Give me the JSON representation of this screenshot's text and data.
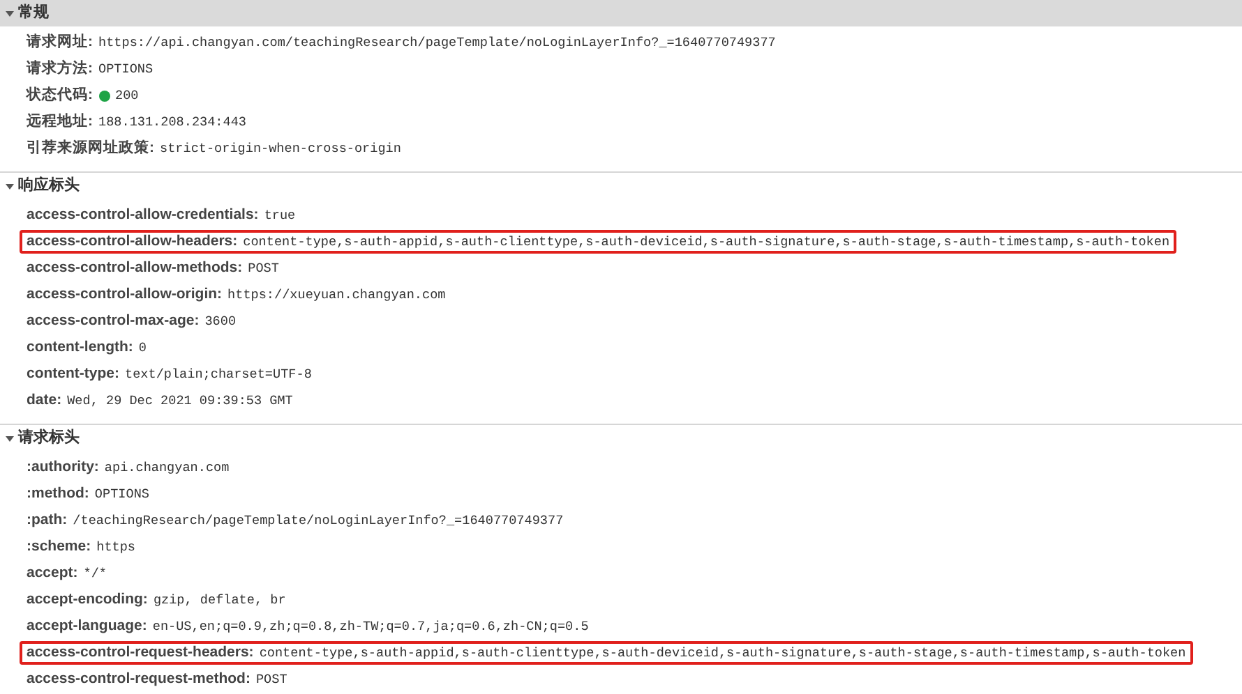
{
  "sections": [
    {
      "title": "常规",
      "expanded": true,
      "selected": true,
      "rows": [
        {
          "name": "请求网址:",
          "value": "https://api.changyan.com/teachingResearch/pageTemplate/noLoginLayerInfo?_=1640770749377",
          "highlighted": false
        },
        {
          "name": "请求方法:",
          "value": "OPTIONS",
          "highlighted": false
        },
        {
          "name": "状态代码:",
          "value": "200",
          "highlighted": false,
          "color": "#1ea446"
        },
        {
          "name": "远程地址:",
          "value": "188.131.208.234:443",
          "highlighted": false
        },
        {
          "name": "引荐来源网址政策:",
          "value": "strict-origin-when-cross-origin",
          "highlighted": false
        }
      ]
    },
    {
      "title": "响应标头",
      "expanded": true,
      "selected": false,
      "rows": [
        {
          "name": "access-control-allow-credentials:",
          "value": "true",
          "highlighted": false
        },
        {
          "name": "access-control-allow-headers:",
          "value": "content-type,s-auth-appid,s-auth-clienttype,s-auth-deviceid,s-auth-signature,s-auth-stage,s-auth-timestamp,s-auth-token",
          "highlighted": true
        },
        {
          "name": "access-control-allow-methods:",
          "value": "POST",
          "highlighted": false
        },
        {
          "name": "access-control-allow-origin:",
          "value": "https://xueyuan.changyan.com",
          "highlighted": false
        },
        {
          "name": "access-control-max-age:",
          "value": "3600",
          "highlighted": false
        },
        {
          "name": "content-length:",
          "value": "0",
          "highlighted": false
        },
        {
          "name": "content-type:",
          "value": "text/plain;charset=UTF-8",
          "highlighted": false
        },
        {
          "name": "date:",
          "value": "Wed, 29 Dec 2021 09:39:53 GMT",
          "highlighted": false
        }
      ]
    },
    {
      "title": "请求标头",
      "expanded": true,
      "selected": false,
      "rows": [
        {
          "name": ":authority:",
          "value": "api.changyan.com",
          "highlighted": false
        },
        {
          "name": ":method:",
          "value": "OPTIONS",
          "highlighted": false
        },
        {
          "name": ":path:",
          "value": "/teachingResearch/pageTemplate/noLoginLayerInfo?_=1640770749377",
          "highlighted": false
        },
        {
          "name": ":scheme:",
          "value": "https",
          "highlighted": false
        },
        {
          "name": "accept:",
          "value": "*/*",
          "highlighted": false
        },
        {
          "name": "accept-encoding:",
          "value": "gzip, deflate, br",
          "highlighted": false
        },
        {
          "name": "accept-language:",
          "value": "en-US,en;q=0.9,zh;q=0.8,zh-TW;q=0.7,ja;q=0.6,zh-CN;q=0.5",
          "highlighted": false
        },
        {
          "name": "access-control-request-headers:",
          "value": "content-type,s-auth-appid,s-auth-clienttype,s-auth-deviceid,s-auth-signature,s-auth-stage,s-auth-timestamp,s-auth-token",
          "highlighted": true
        },
        {
          "name": "access-control-request-method:",
          "value": "POST",
          "highlighted": false
        }
      ]
    }
  ]
}
